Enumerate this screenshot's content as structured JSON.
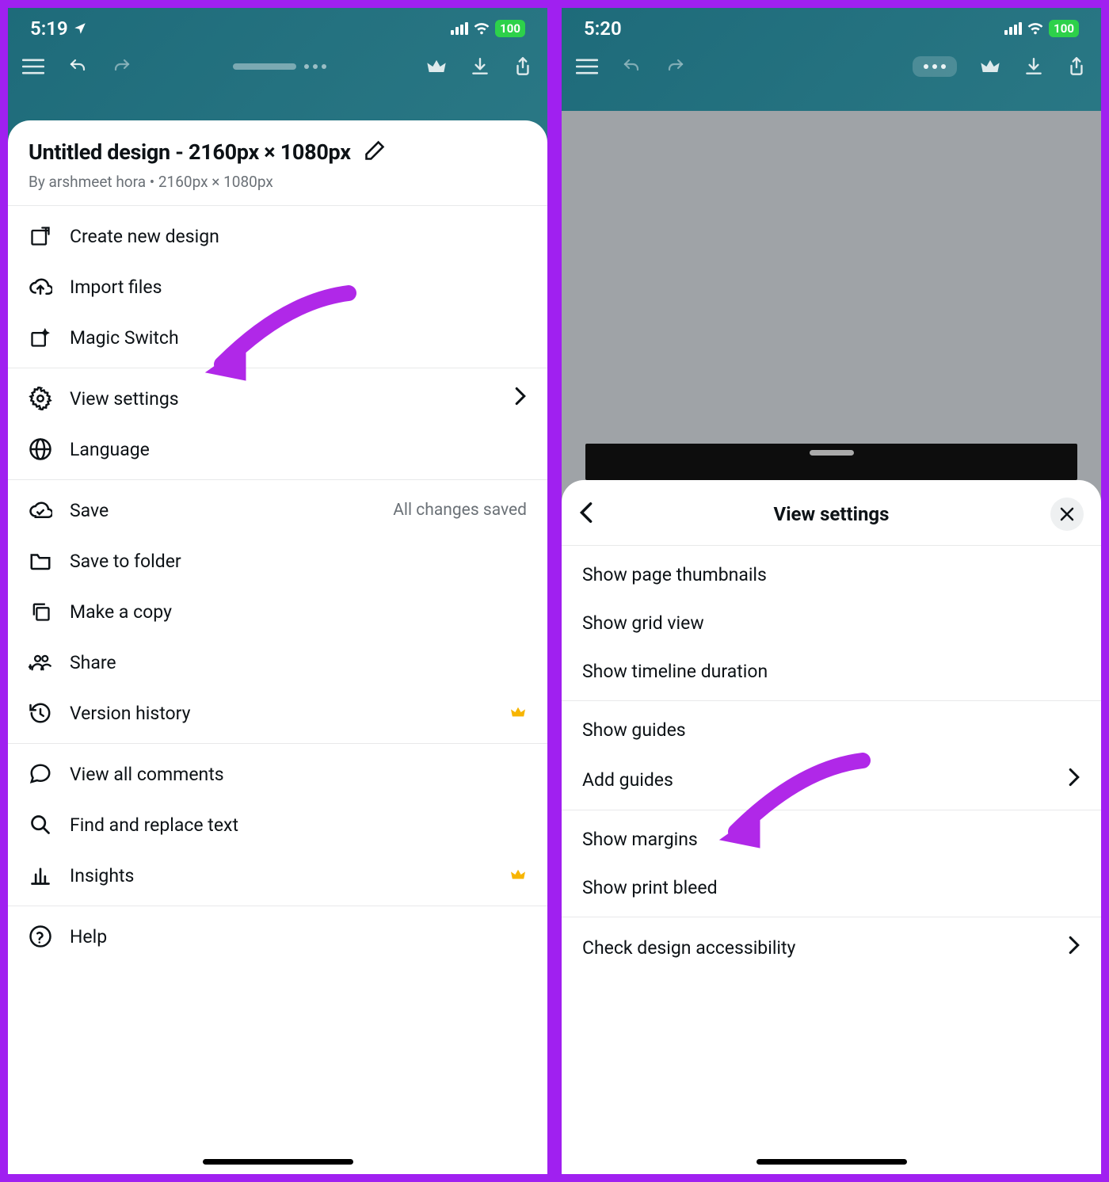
{
  "left": {
    "status": {
      "time": "5:19",
      "battery": "100"
    },
    "designTitle": "Untitled design - 2160px × 1080px",
    "subtitle": "By arshmeet hora • 2160px × 1080px",
    "group1": {
      "createNew": "Create new design",
      "importFiles": "Import files",
      "magicSwitch": "Magic Switch"
    },
    "group2": {
      "viewSettings": "View settings",
      "language": "Language"
    },
    "group3": {
      "save": "Save",
      "saveHint": "All changes saved",
      "saveFolder": "Save to folder",
      "makeCopy": "Make a copy",
      "share": "Share",
      "versionHistory": "Version history"
    },
    "group4": {
      "viewComments": "View all comments",
      "findReplace": "Find and replace text",
      "insights": "Insights"
    },
    "group5": {
      "help": "Help"
    }
  },
  "right": {
    "status": {
      "time": "5:20",
      "battery": "100"
    },
    "sheetTitle": "View settings",
    "group1": {
      "pageThumbs": "Show page thumbnails",
      "gridView": "Show grid view",
      "timelineDuration": "Show timeline duration"
    },
    "group2": {
      "showGuides": "Show guides",
      "addGuides": "Add guides"
    },
    "group3": {
      "showMargins": "Show margins",
      "printBleed": "Show print bleed"
    },
    "group4": {
      "accessibility": "Check design accessibility"
    }
  }
}
